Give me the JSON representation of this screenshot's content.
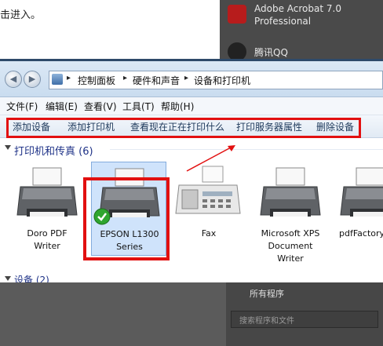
{
  "background": {
    "fragment_text": "击进入。",
    "start_menu": [
      {
        "line1": "Adobe Acrobat 7.0",
        "line2": "Professional"
      },
      {
        "line1": "腾讯QQ",
        "line2": ""
      }
    ],
    "all_programs": "所有程序",
    "search_placeholder": "搜索程序和文件"
  },
  "address": {
    "crumbs": [
      "控制面板",
      "硬件和声音",
      "设备和打印机"
    ]
  },
  "menu": [
    "文件(F)",
    "编辑(E)",
    "查看(V)",
    "工具(T)",
    "帮助(H)"
  ],
  "toolbar": [
    "添加设备",
    "添加打印机",
    "查看现在正在打印什么",
    "打印服务器属性",
    "删除设备"
  ],
  "groups": {
    "printers_title": "打印机和传真 (6)",
    "devices_title": "设备 (2)"
  },
  "devices": [
    {
      "name": "Doro PDF Writer",
      "line1": "Doro PDF",
      "line2": "Writer",
      "line3": "",
      "icon": "printer-icon"
    },
    {
      "name": "EPSON L1300 Series",
      "line1": "EPSON L1300",
      "line2": "Series",
      "line3": "",
      "icon": "printer-icon",
      "default": true
    },
    {
      "name": "Fax",
      "line1": "Fax",
      "line2": "",
      "line3": "",
      "icon": "fax-icon"
    },
    {
      "name": "Microsoft XPS Document Writer",
      "line1": "Microsoft XPS",
      "line2": "Document",
      "line3": "Writer",
      "icon": "printer-icon"
    },
    {
      "name": "pdfFactory",
      "line1": "pdfFactory",
      "line2": "",
      "line3": "",
      "icon": "printer-icon"
    }
  ],
  "colors": {
    "highlight_red": "#e21010",
    "selection_blue": "#cfe3fb",
    "group_title": "#1e3287"
  }
}
